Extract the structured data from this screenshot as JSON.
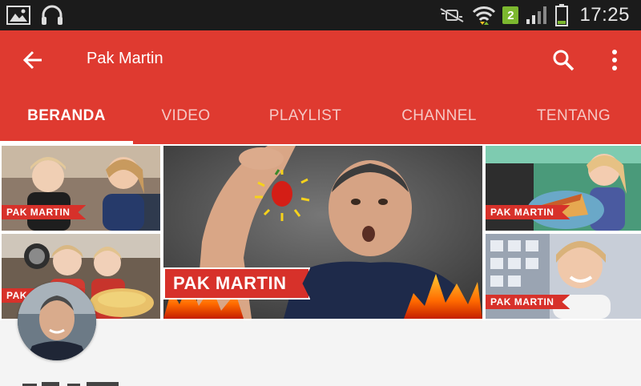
{
  "status_bar": {
    "time": "17:25",
    "sim_slot": "2",
    "icons": [
      "gallery-icon",
      "headphones-icon",
      "mute-icon",
      "wifi-icon",
      "signal-icon",
      "battery-icon"
    ]
  },
  "toolbar": {
    "title": "Pak Martin",
    "back_icon": "arrow-left-icon",
    "search_icon": "search-icon",
    "more_icon": "more-vert-icon"
  },
  "tabs": [
    {
      "label": "BERANDA",
      "active": true
    },
    {
      "label": "VIDEO",
      "active": false
    },
    {
      "label": "PLAYLIST",
      "active": false
    },
    {
      "label": "CHANNEL",
      "active": false
    },
    {
      "label": "TENTANG",
      "active": false
    }
  ],
  "banner": {
    "labels": [
      "PAK MARTIN",
      "PAK MARTIN",
      "PAK MARTIN",
      "PAK MARTIN",
      "PAK MARTIN"
    ]
  },
  "colors": {
    "accent": "#df3a30",
    "status_bar": "#1b1b1b",
    "label_red": "#d7312a"
  }
}
